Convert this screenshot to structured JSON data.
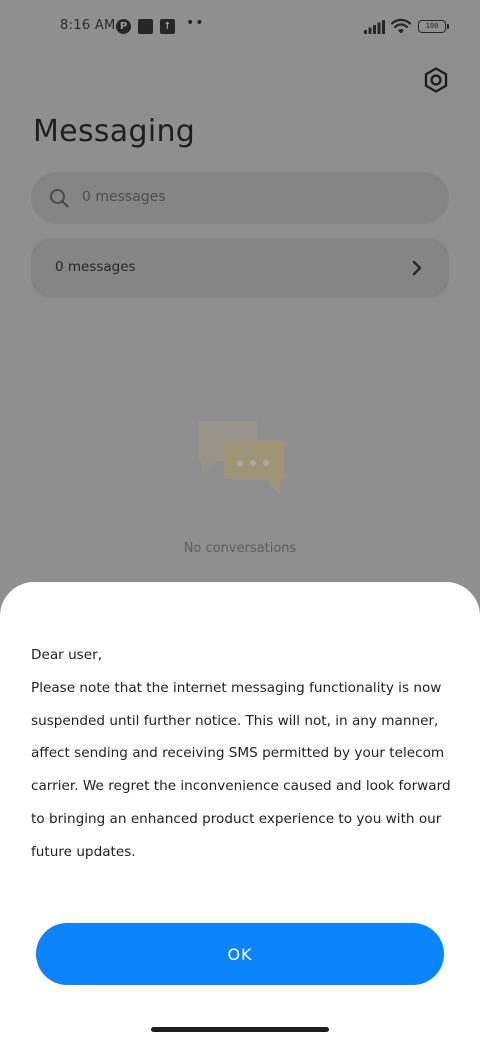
{
  "status_bar": {
    "time": "8:16 AM",
    "overflow_dots": "••",
    "battery": "100"
  },
  "header": {
    "title": "Messaging"
  },
  "search": {
    "placeholder": "0 messages"
  },
  "messages_row": {
    "label": "0 messages"
  },
  "empty_state": {
    "text": "No conversations"
  },
  "dialog": {
    "greeting": "Dear user,",
    "body": "Please note that the internet messaging functionality is now suspended until further notice. This will not, in any manner, affect sending and receiving SMS permitted by your telecom carrier. We regret the inconvenience caused and look forward to bringing an enhanced product experience to you with our future updates.",
    "ok_label": "OK"
  },
  "colors": {
    "accent": "#0c84fb",
    "scrim_background": "#8f8f8f",
    "sheet_background": "#ffffff"
  }
}
